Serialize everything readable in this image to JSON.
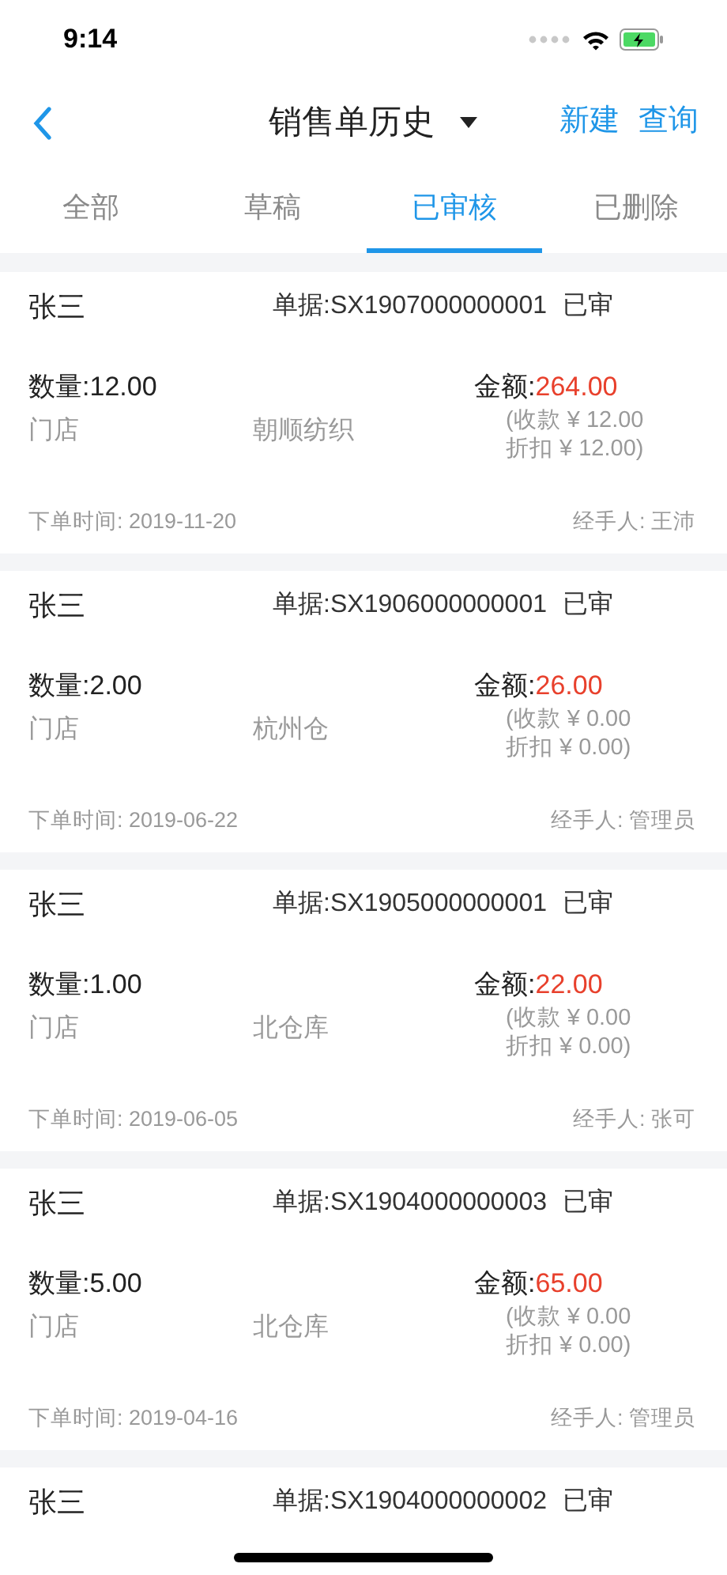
{
  "status_bar": {
    "time": "9:14"
  },
  "nav": {
    "title": "销售单历史",
    "actions": [
      "新建",
      "查询"
    ]
  },
  "tabs": [
    {
      "label": "全部",
      "selected": false
    },
    {
      "label": "草稿",
      "selected": false
    },
    {
      "label": "已审核",
      "selected": true
    },
    {
      "label": "已删除",
      "selected": false
    }
  ],
  "orders": [
    {
      "customer": "张三",
      "doc": "单据:SX1907000000001",
      "status": "已审",
      "qty_label": "数量:",
      "qty": "12.00",
      "amount_label": "金额:",
      "amount": "264.00",
      "store": "门店",
      "warehouse": "朝顺纺织",
      "received": "(收款 ¥ 12.00",
      "discount": "折扣 ¥ 12.00)",
      "date": "下单时间: 2019-11-20",
      "handler": "经手人: 王沛"
    },
    {
      "customer": "张三",
      "doc": "单据:SX1906000000001",
      "status": "已审",
      "qty_label": "数量:",
      "qty": "2.00",
      "amount_label": "金额:",
      "amount": "26.00",
      "store": "门店",
      "warehouse": "杭州仓",
      "received": "(收款 ¥ 0.00",
      "discount": "折扣 ¥ 0.00)",
      "date": "下单时间: 2019-06-22",
      "handler": "经手人: 管理员"
    },
    {
      "customer": "张三",
      "doc": "单据:SX1905000000001",
      "status": "已审",
      "qty_label": "数量:",
      "qty": "1.00",
      "amount_label": "金额:",
      "amount": "22.00",
      "store": "门店",
      "warehouse": "北仓库",
      "received": "(收款 ¥ 0.00",
      "discount": "折扣 ¥ 0.00)",
      "date": "下单时间: 2019-06-05",
      "handler": "经手人: 张可"
    },
    {
      "customer": "张三",
      "doc": "单据:SX1904000000003",
      "status": "已审",
      "qty_label": "数量:",
      "qty": "5.00",
      "amount_label": "金额:",
      "amount": "65.00",
      "store": "门店",
      "warehouse": "北仓库",
      "received": "(收款 ¥ 0.00",
      "discount": "折扣 ¥ 0.00)",
      "date": "下单时间: 2019-04-16",
      "handler": "经手人: 管理员"
    },
    {
      "customer": "张三",
      "doc": "单据:SX1904000000002",
      "status": "已审"
    }
  ]
}
